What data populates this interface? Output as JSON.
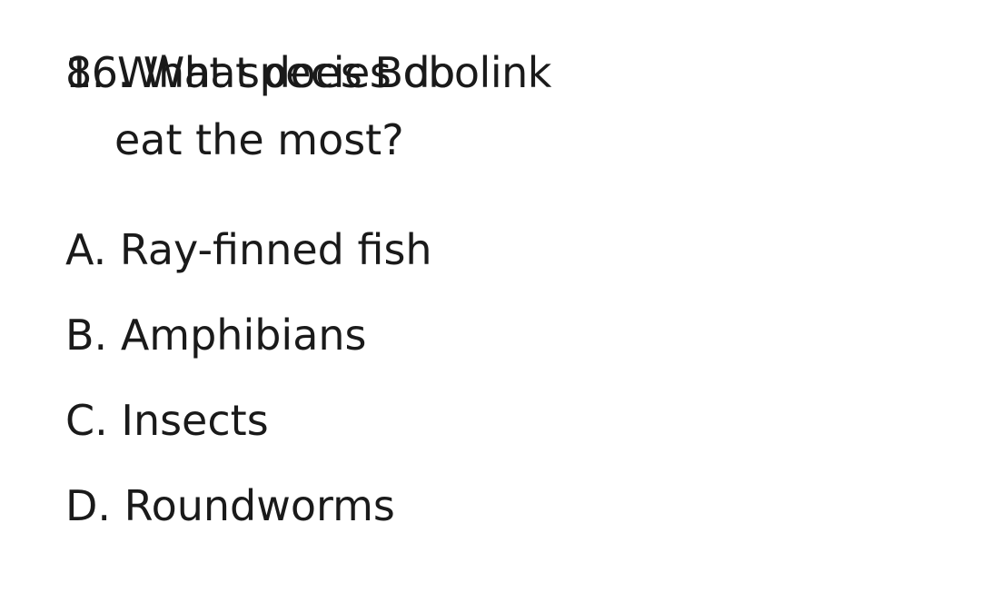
{
  "question": {
    "layer_a": "16. What does Bobolink",
    "layer_b": "8. What species do",
    "line2": "eat the most?"
  },
  "options": [
    {
      "letter": "A.",
      "text": "Ray-finned fish"
    },
    {
      "letter": "B.",
      "text": "Amphibians"
    },
    {
      "letter": "C.",
      "text": "Insects"
    },
    {
      "letter": "D.",
      "text": "Roundworms"
    }
  ]
}
